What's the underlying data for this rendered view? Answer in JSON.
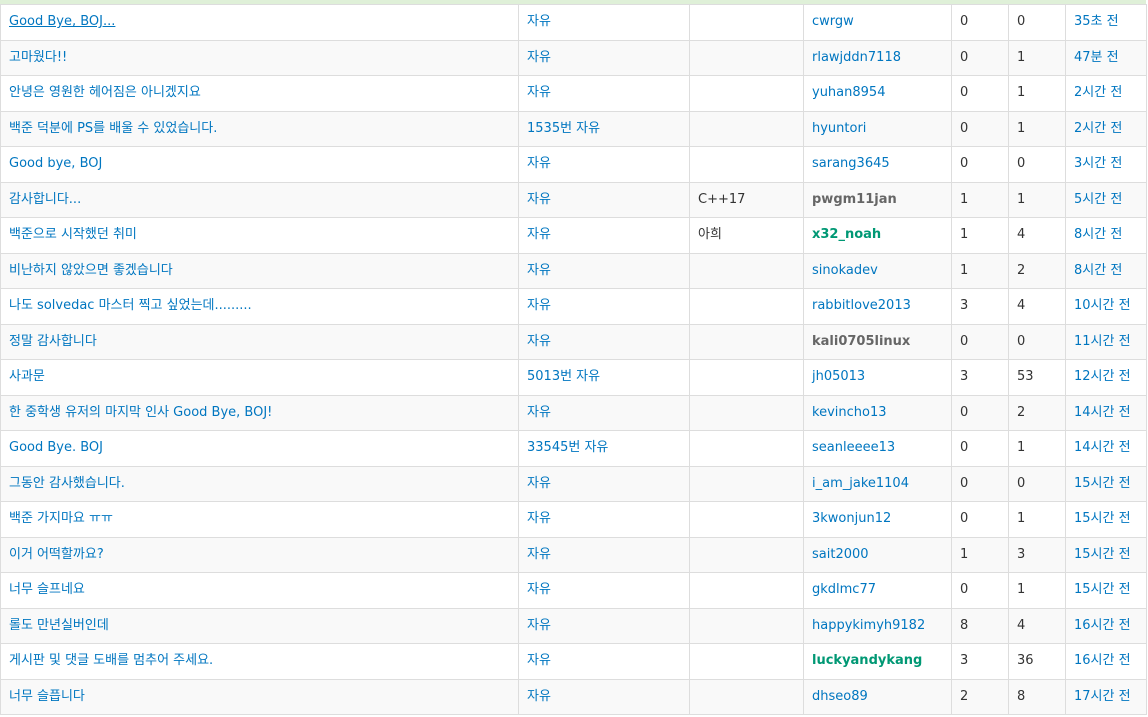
{
  "rows": [
    {
      "title": "Good Bye, BOJ...",
      "category": "자유",
      "lang": "",
      "user": "cwrgw",
      "likes": "0",
      "comments": "0",
      "time": "35초 전"
    },
    {
      "title": "고마웠다!!",
      "category": "자유",
      "lang": "",
      "user": "rlawjddn7118",
      "likes": "0",
      "comments": "1",
      "time": "47분 전"
    },
    {
      "title": "안녕은 영원한 헤어짐은 아니겠지요",
      "category": "자유",
      "lang": "",
      "user": "yuhan8954",
      "likes": "0",
      "comments": "1",
      "time": "2시간 전"
    },
    {
      "title": "백준 덕분에 PS를 배울 수 있었습니다.",
      "category": "1535번 자유",
      "lang": "",
      "user": "hyuntori",
      "likes": "0",
      "comments": "1",
      "time": "2시간 전"
    },
    {
      "title": "Good bye, BOJ",
      "category": "자유",
      "lang": "",
      "user": "sarang3645",
      "likes": "0",
      "comments": "0",
      "time": "3시간 전"
    },
    {
      "title": "감사합니다...",
      "category": "자유",
      "lang": "C++17",
      "user": "pwgm11jan",
      "likes": "1",
      "comments": "1",
      "time": "5시간 전"
    },
    {
      "title": "백준으로 시작했던 취미",
      "category": "자유",
      "lang": "아희",
      "user": "x32_noah",
      "likes": "1",
      "comments": "4",
      "time": "8시간 전"
    },
    {
      "title": "비난하지 않았으면 좋겠습니다",
      "category": "자유",
      "lang": "",
      "user": "sinokadev",
      "likes": "1",
      "comments": "2",
      "time": "8시간 전"
    },
    {
      "title": "나도 solvedac 마스터 찍고 싶었는데.........",
      "category": "자유",
      "lang": "",
      "user": "rabbitlove2013",
      "likes": "3",
      "comments": "4",
      "time": "10시간 전"
    },
    {
      "title": "정말 감사합니다",
      "category": "자유",
      "lang": "",
      "user": "kali0705linux",
      "likes": "0",
      "comments": "0",
      "time": "11시간 전"
    },
    {
      "title": "사과문",
      "category": "5013번 자유",
      "lang": "",
      "user": "jh05013",
      "likes": "3",
      "comments": "53",
      "time": "12시간 전"
    },
    {
      "title": "한 중학생 유저의 마지막 인사 Good Bye, BOJ!",
      "category": "자유",
      "lang": "",
      "user": "kevincho13",
      "likes": "0",
      "comments": "2",
      "time": "14시간 전"
    },
    {
      "title": "Good Bye. BOJ",
      "category": "33545번 자유",
      "lang": "",
      "user": "seanleeee13",
      "likes": "0",
      "comments": "1",
      "time": "14시간 전"
    },
    {
      "title": "그동안 감사했습니다.",
      "category": "자유",
      "lang": "",
      "user": "i_am_jake1104",
      "likes": "0",
      "comments": "0",
      "time": "15시간 전"
    },
    {
      "title": "백준 가지마요 ㅠㅠ",
      "category": "자유",
      "lang": "",
      "user": "3kwonjun12",
      "likes": "0",
      "comments": "1",
      "time": "15시간 전"
    },
    {
      "title": "이거 어떡할까요?",
      "category": "자유",
      "lang": "",
      "user": "sait2000",
      "likes": "1",
      "comments": "3",
      "time": "15시간 전"
    },
    {
      "title": "너무 슬프네요",
      "category": "자유",
      "lang": "",
      "user": "gkdlmc77",
      "likes": "0",
      "comments": "1",
      "time": "15시간 전"
    },
    {
      "title": "롤도 만년실버인데",
      "category": "자유",
      "lang": "",
      "user": "happykimyh9182",
      "likes": "8",
      "comments": "4",
      "time": "16시간 전"
    },
    {
      "title": "게시판 및 댓글 도배를 멈추어 주세요.",
      "category": "자유",
      "lang": "",
      "user": "luckyandykang",
      "likes": "3",
      "comments": "36",
      "time": "16시간 전"
    },
    {
      "title": "너무 슬픕니다",
      "category": "자유",
      "lang": "",
      "user": "dhseo89",
      "likes": "2",
      "comments": "8",
      "time": "17시간 전"
    }
  ]
}
